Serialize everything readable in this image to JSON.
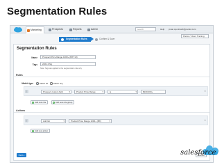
{
  "slide": {
    "title": "Segmentation Rules"
  },
  "topnav": {
    "tabs": [
      {
        "label": "Marketing",
        "icon": "megaphone-icon",
        "color": "#e07a2a"
      },
      {
        "label": "Prospects",
        "icon": "people-icon",
        "color": "#7f8c99"
      },
      {
        "label": "Reports",
        "icon": "bar-chart-icon",
        "color": "#7f8c99"
      },
      {
        "label": "Admin",
        "icon": "gear-icon",
        "color": "#7f8c99"
      }
    ],
    "search_placeholder": "search",
    "help_label": "Help",
    "user_label": "jovan.spontinelli@pardot.com",
    "account_label": "Pardot / Client Training"
  },
  "steps": [
    {
      "label": "Segmentation Rules"
    },
    {
      "label": "Confirm & Save"
    }
  ],
  "form": {
    "title": "Segmentation Rules",
    "name_label": "Name",
    "name_value": "Prospect Price Range 1000+ (BXY13)",
    "tags_label": "Tags",
    "tags_value": "2401-3 Ng",
    "tags_note": "Note: Tags are applied to the segmentation rule only"
  },
  "rules": {
    "section_label": "Rules",
    "match_label": "Match type",
    "match_all": "Match all",
    "match_any": "Match any",
    "row": {
      "field1": "Prospect custom field",
      "field2": "Product Price Range",
      "operator": "is",
      "value": "$100,000+"
    },
    "add_rule_label": "Add new rule",
    "add_group_label": "Add new rule group"
  },
  "actions": {
    "section_label": "Actions",
    "row": {
      "action": "Add list",
      "target": "Product Price Range 1000+ (BX)"
    },
    "add_action_label": "Add new action"
  },
  "footer": {
    "next_label": "Next »",
    "cancel_label": "Cancel"
  },
  "brand": {
    "text": "salesforce",
    "cloud_color": "#2ea3e0"
  }
}
